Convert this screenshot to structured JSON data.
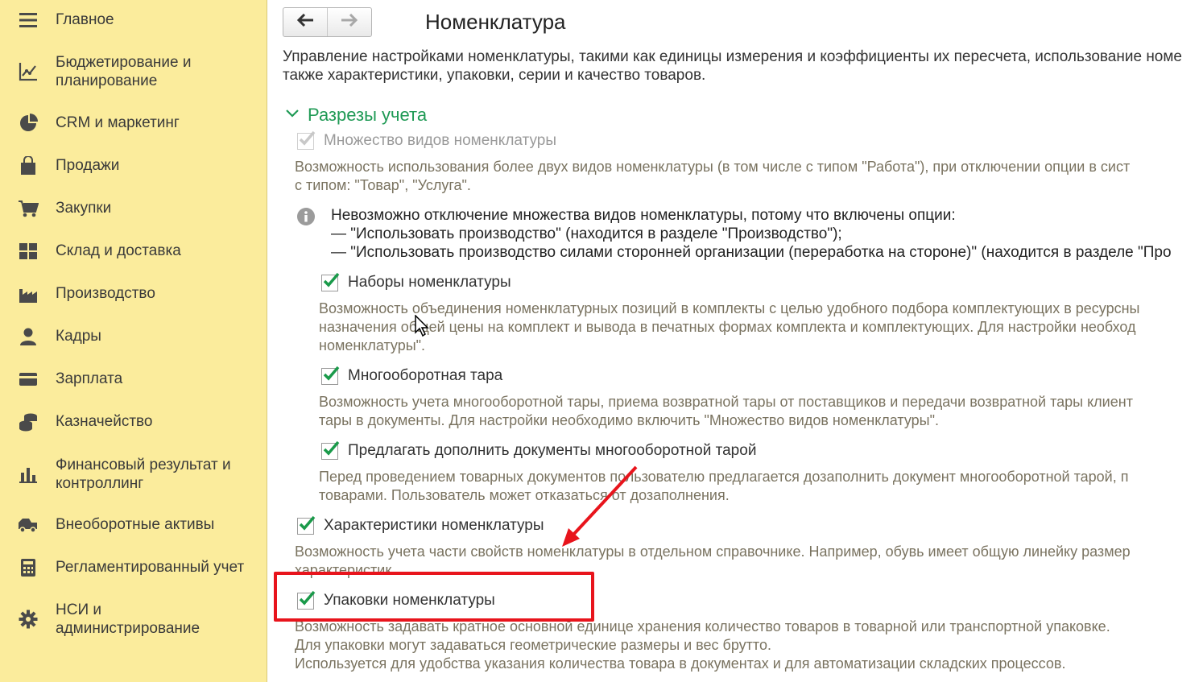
{
  "sidebar": {
    "items": [
      {
        "label": "Главное",
        "icon": "menu-icon"
      },
      {
        "label": "Бюджетирование и\nпланирование",
        "icon": "budget-chart-icon"
      },
      {
        "label": "CRM и маркетинг",
        "icon": "pie-chart-icon"
      },
      {
        "label": "Продажи",
        "icon": "shopping-bag-icon"
      },
      {
        "label": "Закупки",
        "icon": "cart-icon"
      },
      {
        "label": "Склад и доставка",
        "icon": "warehouse-icon"
      },
      {
        "label": "Производство",
        "icon": "factory-icon"
      },
      {
        "label": "Кадры",
        "icon": "person-icon"
      },
      {
        "label": "Зарплата",
        "icon": "card-icon"
      },
      {
        "label": "Казначейство",
        "icon": "coins-icon"
      },
      {
        "label": "Финансовый результат и\nконтроллинг",
        "icon": "bar-chart-icon"
      },
      {
        "label": "Внеоборотные активы",
        "icon": "truck-icon"
      },
      {
        "label": "Регламентированный учет",
        "icon": "calculator-icon"
      },
      {
        "label": "НСИ и\nадминистрирование",
        "icon": "gear-icon"
      }
    ]
  },
  "header": {
    "title": "Номенклатура",
    "back_icon": "arrow-left-icon",
    "forward_icon": "arrow-right-icon"
  },
  "intro": {
    "line1": "Управление настройками номенклатуры, такими как единицы измерения и коэффициенты их пересчета, использование номе",
    "line2": "также характеристики, упаковки, серии и качество товаров."
  },
  "section": {
    "label": "Разрезы учета",
    "expanded": true
  },
  "options": {
    "many_kinds": {
      "label": "Множество видов номенклатуры",
      "checked": true,
      "disabled": true,
      "desc1": "Возможность использования более двух видов номенклатуры (в том числе с типом \"Работа\"), при отключении опции в сист",
      "desc2": "с типом: \"Товар\", \"Услуга\"."
    },
    "info": {
      "line1": "Невозможно отключение множества видов номенклатуры, потому что включены опции:",
      "line2": "— \"Использовать производство\" (находится в разделе \"Производство\");",
      "line3": "— \"Использовать производство силами сторонней организации (переработка на стороне)\" (находится в разделе \"Про"
    },
    "sets": {
      "label": "Наборы номенклатуры",
      "checked": true,
      "desc1": "Возможность объединения номенклатурных позиций в комплекты с целью удобного подбора комплектующих в ресурсны",
      "desc2": "назначения общей цены на комплект и вывода в печатных формах комплекта и комплектующих. Для настройки необход",
      "desc3": "номенклатуры\"."
    },
    "returnable": {
      "label": "Многооборотная тара",
      "checked": true,
      "desc1": "Возможность учета многооборотной тары, приема возвратной тары от поставщиков и передачи возвратной тары клиент",
      "desc2": "тары в документы. Для настройки необходимо включить \"Множество видов номенклатуры\"."
    },
    "suggest_fill": {
      "label": "Предлагать дополнить документы многооборотной тарой",
      "checked": true,
      "desc1": "Перед проведением товарных документов пользователю предлагается дозаполнить документ многооборотной тарой, п",
      "desc2": "товарами. Пользователь может отказаться от дозаполнения."
    },
    "characteristics": {
      "label": "Характеристики номенклатуры",
      "checked": true,
      "desc1": "Возможность учета части свойств номенклатуры в отдельном справочнике. Например, обувь имеет общую линейку размер",
      "desc2": "характеристик."
    },
    "packages": {
      "label": "Упаковки номенклатуры",
      "checked": true,
      "desc1": "Возможность задавать кратное основной единице хранения количество товаров в товарной или транспортной упаковке.",
      "desc2": "Для упаковки могут задаваться геометрические размеры и вес брутто.",
      "desc3": "Используется для удобства указания количества товара в документах и для автоматизации складских процессов."
    }
  },
  "colors": {
    "sidebar_bg": "#fbec9c",
    "section_green": "#1f9a55",
    "check_green": "#1a9a4a",
    "highlight_red": "#e8141c",
    "description_text": "#7a7360"
  }
}
